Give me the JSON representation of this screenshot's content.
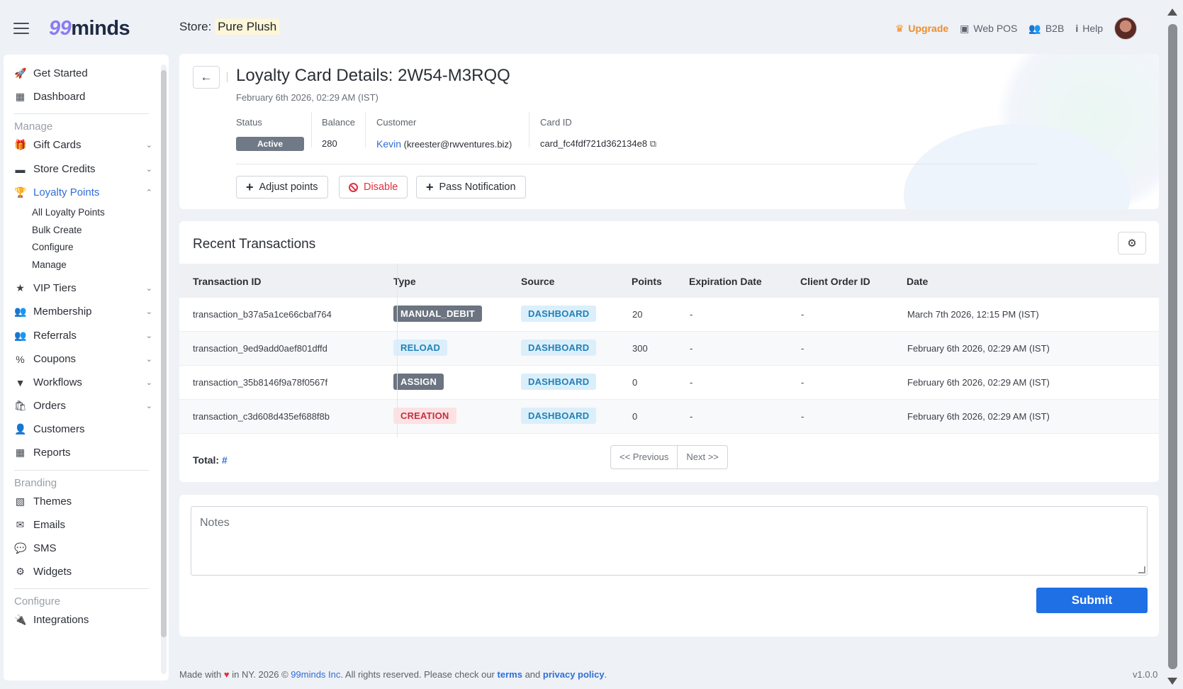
{
  "header": {
    "logo_digits": "99",
    "logo_text": "minds",
    "store_label": "Store:",
    "store_name": "Pure Plush",
    "upgrade_label": "Upgrade",
    "webpos_label": "Web POS",
    "b2b_label": "B2B",
    "help_label": "Help"
  },
  "sidebar": {
    "get_started": "Get Started",
    "dashboard": "Dashboard",
    "manage_section": "Manage",
    "gift_cards": "Gift Cards",
    "store_credits": "Store Credits",
    "loyalty_points": "Loyalty Points",
    "sub_all": "All Loyalty Points",
    "sub_bulk": "Bulk Create",
    "sub_configure": "Configure",
    "sub_manage": "Manage",
    "vip_tiers": "VIP Tiers",
    "membership": "Membership",
    "referrals": "Referrals",
    "coupons": "Coupons",
    "workflows": "Workflows",
    "orders": "Orders",
    "customers": "Customers",
    "reports": "Reports",
    "branding_section": "Branding",
    "themes": "Themes",
    "emails": "Emails",
    "sms": "SMS",
    "widgets": "Widgets",
    "configure_section": "Configure",
    "integrations": "Integrations"
  },
  "details": {
    "title": "Loyalty Card Details: 2W54-M3RQQ",
    "date": "February 6th 2026, 02:29 AM (IST)",
    "status_label": "Status",
    "status_value": "Active",
    "balance_label": "Balance",
    "balance_value": "280",
    "customer_label": "Customer",
    "customer_name": "Kevin",
    "customer_email": "(kreester@rwventures.biz)",
    "cardid_label": "Card ID",
    "cardid_value": "card_fc4fdf721d362134e8",
    "adjust_label": "Adjust points",
    "disable_label": "Disable",
    "pass_label": "Pass Notification"
  },
  "transactions": {
    "title": "Recent Transactions",
    "headers": [
      "Transaction ID",
      "Type",
      "Source",
      "Points",
      "Expiration Date",
      "Client Order ID",
      "Date"
    ],
    "rows": [
      {
        "id": "transaction_b37a5a1ce66cbaf764",
        "type": "MANUAL_DEBIT",
        "source": "DASHBOARD",
        "points": "20",
        "exp": "-",
        "order": "-",
        "date": "March 7th 2026, 12:15 PM (IST)"
      },
      {
        "id": "transaction_9ed9add0aef801dffd",
        "type": "RELOAD",
        "source": "DASHBOARD",
        "points": "300",
        "exp": "-",
        "order": "-",
        "date": "February 6th 2026, 02:29 AM (IST)"
      },
      {
        "id": "transaction_35b8146f9a78f0567f",
        "type": "ASSIGN",
        "source": "DASHBOARD",
        "points": "0",
        "exp": "-",
        "order": "-",
        "date": "February 6th 2026, 02:29 AM (IST)"
      },
      {
        "id": "transaction_c3d608d435ef688f8b",
        "type": "CREATION",
        "source": "DASHBOARD",
        "points": "0",
        "exp": "-",
        "order": "-",
        "date": "February 6th 2026, 02:29 AM (IST)"
      }
    ],
    "total_label": "Total:",
    "total_value": "#",
    "prev_label": "<< Previous",
    "next_label": "Next >>"
  },
  "notes": {
    "placeholder": "Notes",
    "submit_label": "Submit"
  },
  "footer": {
    "made_with": "Made with",
    "in_ny": "in NY.  2026 ©",
    "company": "99minds Inc",
    "rights": ". All rights reserved. Please check our",
    "terms": "terms",
    "and": "and",
    "privacy": "privacy policy",
    "period": ".",
    "version": "v1.0.0"
  },
  "colors": {
    "accent": "#1f6fe5",
    "upgrade": "#f08c2b",
    "danger": "#e0303f",
    "active_badge": "#707986"
  }
}
